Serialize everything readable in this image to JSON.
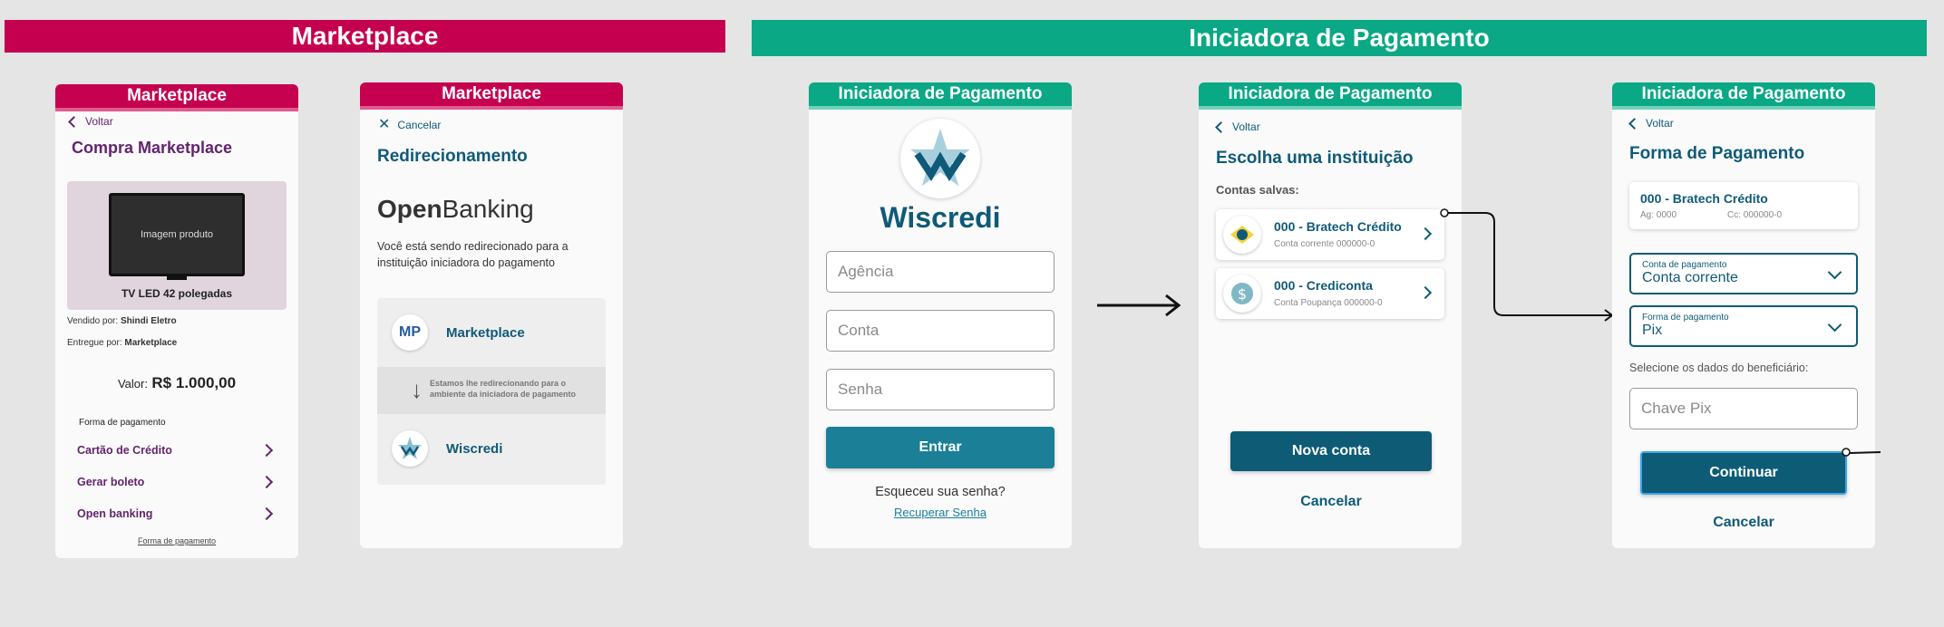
{
  "banners": {
    "marketplace": "Marketplace",
    "initiator": "Iniciadora de Pagamento"
  },
  "screen1": {
    "header": "Marketplace",
    "back": "Voltar",
    "title": "Compra Marketplace",
    "product_image": "Imagem produto",
    "product_name": "TV LED 42 polegadas",
    "sold_by_label": "Vendido por:",
    "sold_by": "Shindi Eletro",
    "delivered_by_label": "Entregue por:",
    "delivered_by": "Marketplace",
    "value_label": "Valor:",
    "value": "R$ 1.000,00",
    "payment_heading": "Forma de pagamento",
    "payment_options": [
      "Cartão de Crédito",
      "Gerar boleto",
      "Open banking"
    ],
    "footer_link": "Forma de pagamento"
  },
  "screen2": {
    "header": "Marketplace",
    "cancel": "Cancelar",
    "title": "Redirecionamento",
    "logo_open": "Open",
    "logo_banking": "Banking",
    "description": "Você está sendo redirecionado para a instituição iniciadora do pagamento",
    "from_badge": "MP",
    "from_name": "Marketplace",
    "redirect_note": "Estamos lhe redirecionando para o ambiente da iniciadora de pagamento",
    "to_name": "Wiscredi"
  },
  "screen3": {
    "header": "Iniciadora de Pagamento",
    "brand": "Wiscredi",
    "agency_placeholder": "Agência",
    "account_placeholder": "Conta",
    "password_placeholder": "Senha",
    "login_button": "Entrar",
    "forgot": "Esqueceu sua senha?",
    "recover": "Recuperar Senha"
  },
  "screen4": {
    "header": "Iniciadora de Pagamento",
    "back": "Voltar",
    "title": "Escolha uma instituição",
    "saved_label": "Contas salvas:",
    "accounts": [
      {
        "name": "000 - Bratech Crédito",
        "detail": "Conta corrente 000000-0"
      },
      {
        "name": "000 - Crediconta",
        "detail": "Conta Poupança 000000-0"
      }
    ],
    "new_account_button": "Nova conta",
    "cancel_button": "Cancelar"
  },
  "screen5": {
    "header": "Iniciadora de Pagamento",
    "back": "Voltar",
    "title": "Forma de Pagamento",
    "account_name": "000 - Bratech Crédito",
    "account_agency": "Ag: 0000",
    "account_number": "Cc: 000000-0",
    "account_select_label": "Conta de pagamento",
    "account_select_value": "Conta corrente",
    "method_select_label": "Forma de pagamento",
    "method_select_value": "Pix",
    "beneficiary_label": "Selecione os dados do beneficiário:",
    "pix_placeholder": "Chave Pix",
    "continue_button": "Continuar",
    "cancel_button": "Cancelar"
  },
  "colors": {
    "pink": "#c5004f",
    "green": "#0aa885",
    "teal": "#0f5a78",
    "purple": "#63246e",
    "button_teal": "#1b7f98"
  }
}
